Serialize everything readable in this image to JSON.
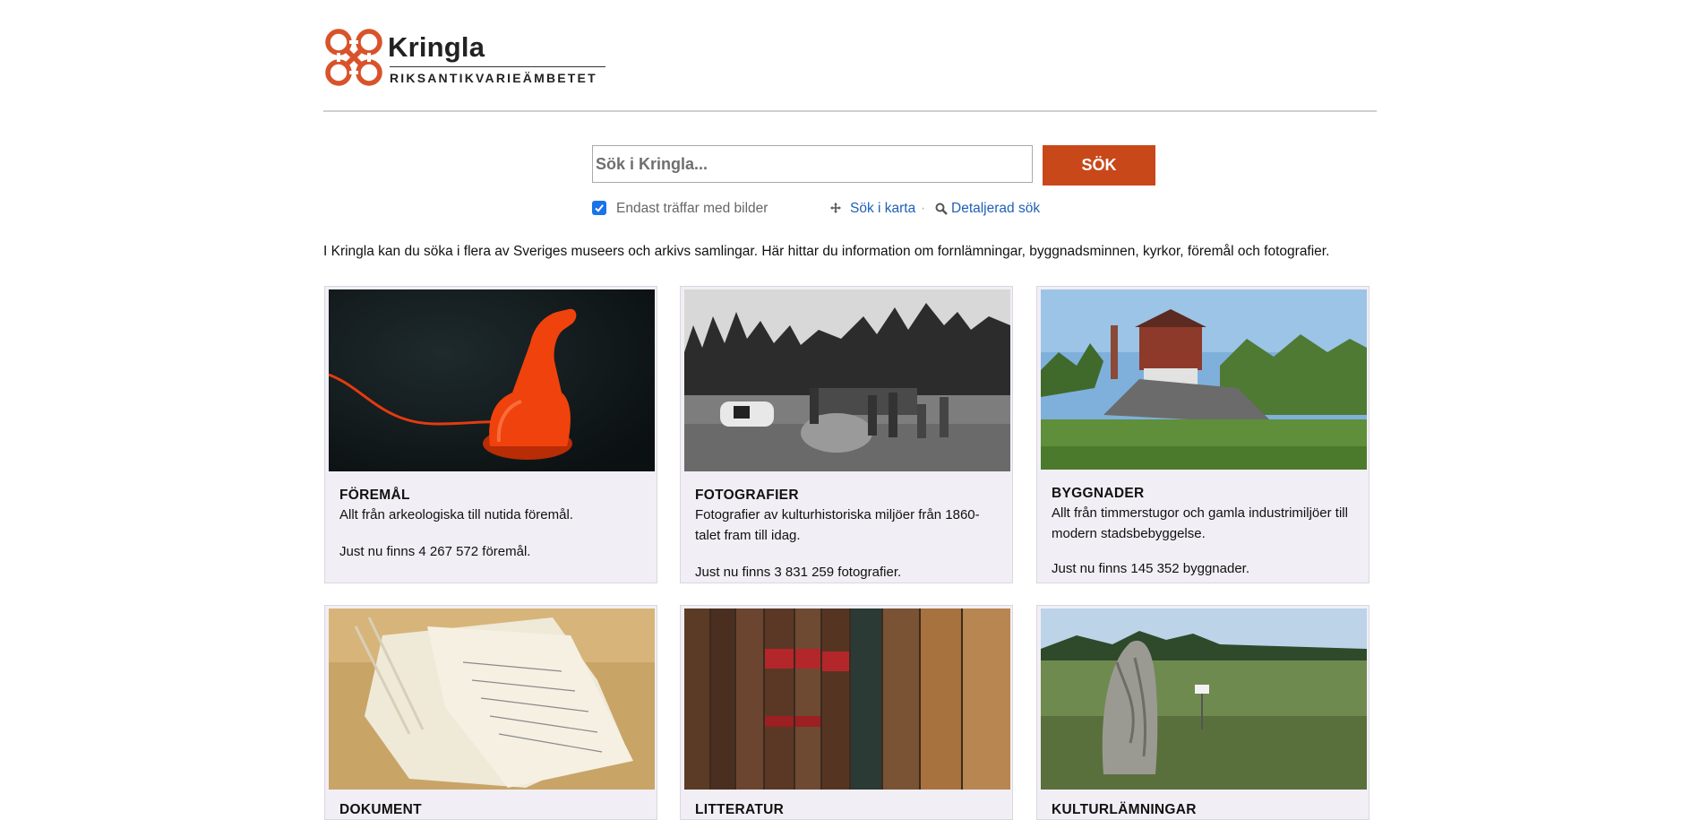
{
  "header": {
    "logo_name": "Kringla",
    "logo_subtitle": "RIKSANTIKVARIEÄMBETET"
  },
  "search": {
    "placeholder": "Sök i Kringla...",
    "button_label": "SÖK",
    "only_images_label": "Endast träffar med bilder",
    "only_images_checked": true,
    "map_search_label": "Sök i karta",
    "separator": "·",
    "advanced_search_label": "Detaljerad sök"
  },
  "intro": "I Kringla kan du söka i flera av Sveriges museers och arkivs samlingar. Här hittar du information om fornlämningar, byggnadsminnen, kyrkor, föremål och fotografier.",
  "categories": [
    {
      "title": "FÖREMÅL",
      "description": "Allt från arkeologiska till nutida föremål.",
      "count_text": "Just nu finns 4 267 572 föremål.",
      "image": "red-telephone-photo"
    },
    {
      "title": "FOTOGRAFIER",
      "description": "Fotografier av kulturhistoriska miljöer från 1860-talet fram till idag.",
      "count_text": "Just nu finns 3 831 259 fotografier.",
      "image": "haymaking-bw-photo"
    },
    {
      "title": "BYGGNADER",
      "description": "Allt från timmerstugor och gamla industrimiljöer till modern stadsbebyggelse.",
      "count_text": "Just nu finns 145 352 byggnader.",
      "image": "industrial-building-photo"
    },
    {
      "title": "DOKUMENT",
      "image": "old-documents-photo"
    },
    {
      "title": "LITTERATUR",
      "image": "old-books-photo"
    },
    {
      "title": "KULTURLÄMNINGAR",
      "image": "runestone-photo"
    }
  ],
  "colors": {
    "brand": "#c9481a",
    "link": "#1f5fb8",
    "card_bg": "#f2eef5"
  }
}
